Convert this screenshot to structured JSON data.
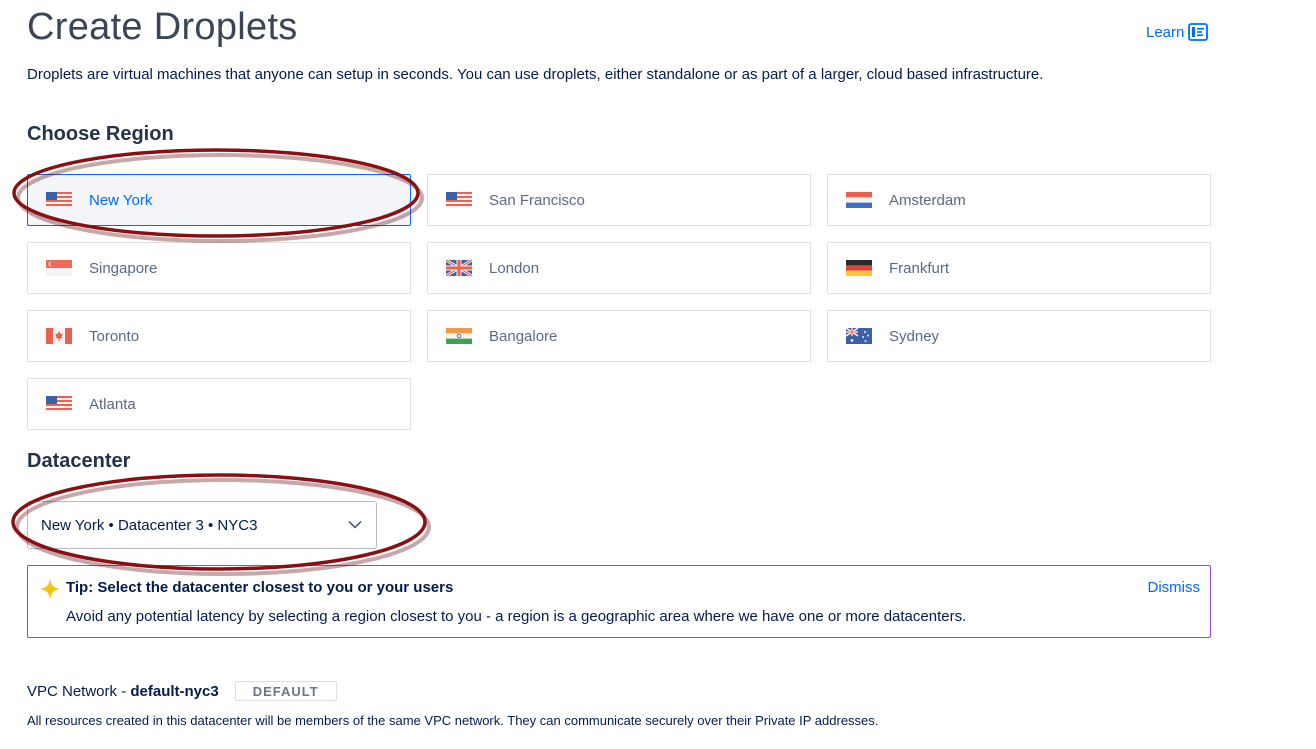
{
  "header": {
    "title": "Create Droplets",
    "learn_label": "Learn",
    "intro": "Droplets are virtual machines that anyone can setup in seconds. You can use droplets, either standalone or as part of a larger, cloud based infrastructure."
  },
  "region_section": {
    "title": "Choose Region",
    "selected": "New York",
    "regions": [
      {
        "label": "New York",
        "flag": "us-flag-icon"
      },
      {
        "label": "San Francisco",
        "flag": "us-flag-icon"
      },
      {
        "label": "Amsterdam",
        "flag": "nl-flag-icon"
      },
      {
        "label": "Singapore",
        "flag": "sg-flag-icon"
      },
      {
        "label": "London",
        "flag": "uk-flag-icon"
      },
      {
        "label": "Frankfurt",
        "flag": "de-flag-icon"
      },
      {
        "label": "Toronto",
        "flag": "ca-flag-icon"
      },
      {
        "label": "Bangalore",
        "flag": "in-flag-icon"
      },
      {
        "label": "Sydney",
        "flag": "au-flag-icon"
      },
      {
        "label": "Atlanta",
        "flag": "us-flag-icon"
      }
    ]
  },
  "datacenter": {
    "title": "Datacenter",
    "selected_value": "New York • Datacenter 3 • NYC3"
  },
  "tip": {
    "title": "Tip: Select the datacenter closest to you or your users",
    "body": "Avoid any potential latency by selecting a region closest to you - a region is a geographic area where we have one or more datacenters.",
    "dismiss_label": "Dismiss"
  },
  "vpc": {
    "prefix": "VPC Network - ",
    "name": "default-nyc3",
    "badge": "DEFAULT",
    "note": "All resources created in this datacenter will be members of the same VPC network. They can communicate securely over their Private IP addresses."
  },
  "colors": {
    "accent": "#0069ff",
    "tip_border": "#9b48d4",
    "annotation": "#8b0f12"
  }
}
